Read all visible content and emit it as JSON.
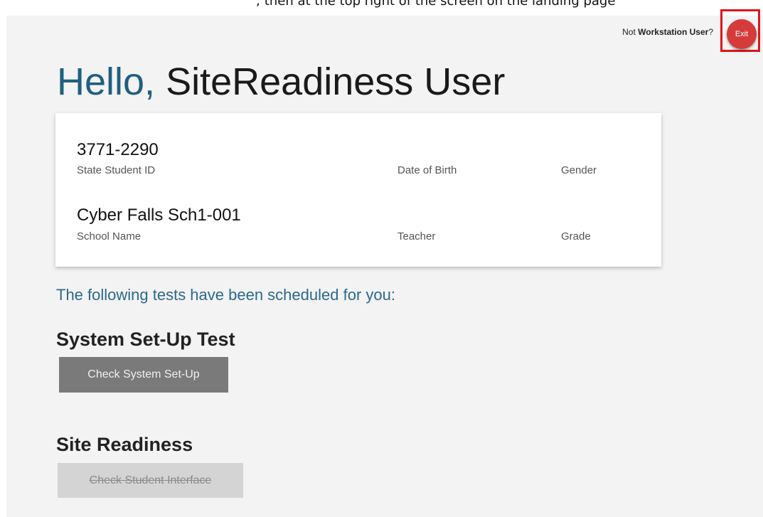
{
  "top_strip_text": "; then at the top right of the screen on the landing page",
  "header": {
    "not_label": "Not",
    "user_name": "Workstation User",
    "question": "?",
    "exit_label": "Exit"
  },
  "greeting": {
    "hello": "Hello,",
    "name": "SiteReadiness User"
  },
  "student_card": {
    "student_id": "3771-2290",
    "student_id_label": "State Student ID",
    "dob_label": "Date of Birth",
    "gender_label": "Gender",
    "school_name": "Cyber Falls Sch1-001",
    "school_name_label": "School Name",
    "teacher_label": "Teacher",
    "grade_label": "Grade"
  },
  "scheduled_heading": "The following tests have been scheduled for you:",
  "tests": [
    {
      "title": "System Set-Up Test",
      "button_label": "Check System Set-Up",
      "enabled": true
    },
    {
      "title": "Site Readiness",
      "button_label": "Check Student Interface",
      "enabled": false
    }
  ],
  "colors": {
    "accent": "#1f5f80",
    "exit_button": "#d63b3b",
    "highlight_box": "#e0151b",
    "active_button": "#7a7a7a",
    "disabled_button": "#d4d4d4"
  }
}
